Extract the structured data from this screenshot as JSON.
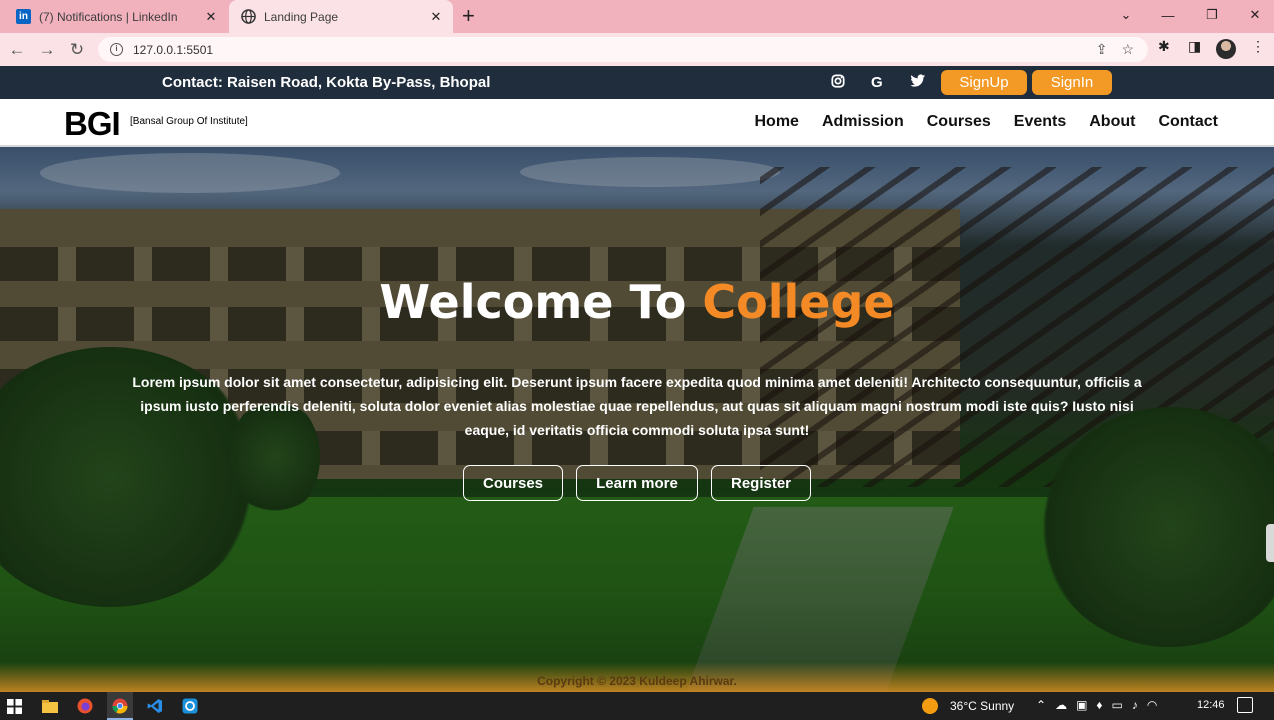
{
  "browser": {
    "tabs": [
      {
        "title": "(7) Notifications | LinkedIn",
        "favicon": "linkedin-icon",
        "active": false
      },
      {
        "title": "Landing Page",
        "favicon": "globe-icon",
        "active": true
      }
    ],
    "new_tab": "+",
    "url": "127.0.0.1:5501"
  },
  "site": {
    "contact": "Contact: Raisen Road, Kokta By-Pass, Bhopal",
    "social": [
      "instagram-icon",
      "google-icon",
      "twitter-icon"
    ],
    "signup_label": "SignUp",
    "signin_label": "SignIn",
    "brand": "BGI",
    "brand_sub": "[Bansal Group Of Institute]",
    "nav": [
      "Home",
      "Admission",
      "Courses",
      "Events",
      "About",
      "Contact"
    ],
    "hero": {
      "headline_prefix": "Welcome To ",
      "headline_accent": "College",
      "body": "Lorem ipsum dolor sit amet consectetur, adipisicing elit. Deserunt ipsum facere expedita quod minima amet deleniti! Architecto consequuntur, officiis a ipsum iusto perferendis deleniti, soluta dolor eveniet alias molestiae quae repellendus, aut quas sit aliquam magni nostrum modi iste quis? Iusto nisi eaque, id veritatis officia commodi soluta ipsa sunt!",
      "buttons": [
        "Courses",
        "Learn more",
        "Register"
      ]
    },
    "copyright": "Copyright © 2023 Kuldeep Ahirwar.",
    "accent_color": "#f39a26",
    "topbar_color": "#1f2d3d"
  },
  "taskbar": {
    "weather": "36°C  Sunny",
    "time": "12:46"
  }
}
